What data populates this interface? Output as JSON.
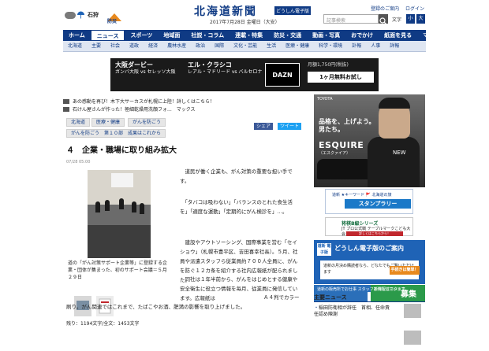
{
  "header": {
    "weather_city": "石狩",
    "bousai_label": "防災",
    "logo": "北海道新聞",
    "logo_tag": "どうしん電子版",
    "date": "2017年7月28日 金曜日（大安）",
    "links": [
      "登録のご案内",
      "ログイン"
    ],
    "search_placeholder": "記事検索",
    "fontsize_label": "文字",
    "font_small": "小",
    "font_large": "大"
  },
  "nav": {
    "items": [
      "ホーム",
      "ニュース",
      "スポーツ",
      "地域面",
      "社説・コラム",
      "連載・特集",
      "防災・交通",
      "動画・写真",
      "おでかけ",
      "紙面を見る",
      "マイページ"
    ],
    "active_index": 1
  },
  "subnav": {
    "items": [
      "北海道",
      "主要",
      "社会",
      "道政",
      "経済",
      "農林水産",
      "政治",
      "国際",
      "文化・芸能",
      "生活",
      "医療・健康",
      "科学・環境",
      "訃報",
      "人事",
      "詳報"
    ]
  },
  "banner": {
    "left_title": "大阪ダービー",
    "left_sub": "ガンバ大阪 vs セレッソ大阪",
    "mid_title": "エル・クラシコ",
    "mid_sub": "レアル・マドリード vs バルセロナ",
    "logo": "DAZN",
    "promo": "月額1,750円(税抜)",
    "cta": "1ヶ月無料お試し"
  },
  "breaking": [
    "あの感動を再び！木下大サーカスが札幌に上陸！詳しくはこちら！",
    "石けん屋さんが作った！極細乾燥用洗顔フォ...　マックス"
  ],
  "tags": [
    "北海道",
    "医療・健康",
    "がんを防ごう"
  ],
  "series_tags": [
    "がんを防ごう　第１０部　成果はこれから"
  ],
  "share": {
    "fb": "シェア",
    "tw": "ツイート"
  },
  "article": {
    "headline": "４　企業・職場に取り組み拡大",
    "date": "07/28 05:00",
    "caption": "道の「がん対策サポート企業等」に登録する企業・団体が集まった、初のサポート会議＝５月２９日",
    "paragraphs": [
      "　道民が働く企業も、がん対策の重要な担い手です。",
      "　「タバコは吸わない」「バランスのとれた食生活を」「適度な運動」「定期的にがん検診を」…。",
      "　建設やアウトソーシング、国際事業を営む「セイショウ」（札幌市豊平区、吉田喜幸社長）。５月、社員や派遣スタッフら従業員約７００人全員に、がんを防ぐ１２カ条を紹介する社内広報紙が配られました。",
      "　同社は１年半前から、がんをはじめとする健康や安全衛生に役立つ情報を毎月、従業員に発信しています。広報紙は"
    ],
    "wide_paragraph": "刷り。がん関連ではこれまで、たばこやお酒、肥満の影響を取り上げました。",
    "wide_paragraph_lead": "Ａ４判でカラー",
    "count": "残り：1194文字/全文：1453文字"
  },
  "ads": {
    "esquire_brand": "TOYOTA",
    "esquire_copy": [
      "品格を、上げよう。",
      "男たち。"
    ],
    "esquire_name": "ESQUIRE",
    "esquire_sub": "（エスクァイア）",
    "esquire_new": "NEW",
    "stamp_top": "道新 ★キーワード 🚩 北海道の旅",
    "stamp_main": "スタンプラリー",
    "shogi_title": "将棋B級シリーズ",
    "shogi_sub": "JT プロ公式戦 テーブルマークこども大会",
    "shogi_cta": "詳しくはこちらから！",
    "denshi_badge": "道新 電子版",
    "denshi_title": "どうしん電子版のご案内",
    "denshi_text": "道新の月決め購読者なら、どなたでもご覧いただけます",
    "denshi_cta": "手続きは簡単！",
    "staff_left": "道新の販売所でお仕事 スタッフお待ちしています。",
    "staff_right": "新聞配達スタッフ",
    "staff_big": "募集"
  },
  "major": {
    "title": "主要ニュース",
    "items": [
      "稲田防衛相が辞任　首相、任命責任認め陳謝",
      ""
    ]
  }
}
